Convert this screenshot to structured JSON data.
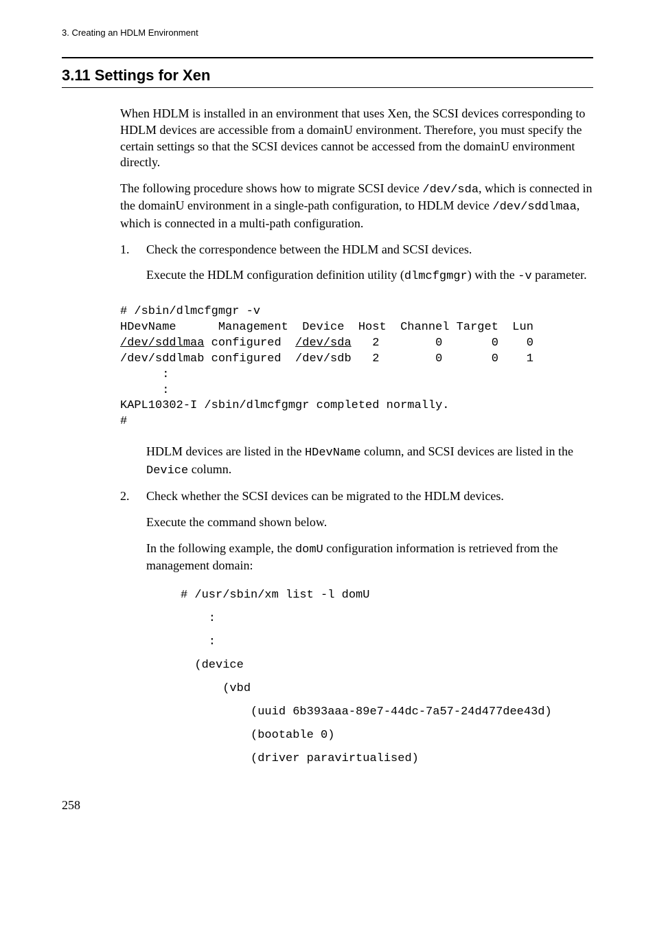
{
  "header": "3. Creating an HDLM Environment",
  "section_title": "3.11 Settings for Xen",
  "para1_pre": "When HDLM is installed in an environment that uses Xen, the SCSI devices corresponding to HDLM devices are accessible from a domainU environment. Therefore, you must specify the certain settings so that the SCSI devices cannot be accessed from the domainU environment directly.",
  "para2": {
    "t1": "The following procedure shows how to migrate SCSI device ",
    "c1": "/dev/sda",
    "t2": ", which is connected in the domainU environment in a single-path configuration, to HDLM device ",
    "c2": "/dev/sddlmaa",
    "t3": ", which is connected in a multi-path configuration."
  },
  "step1": {
    "num": "1.",
    "title": "Check the correspondence between the HDLM and SCSI devices.",
    "sub": {
      "t1": "Execute the HDLM configuration definition utility (",
      "c1": "dlmcfgmgr",
      "t2": ") with the ",
      "c2": "-v",
      "t3": " parameter."
    },
    "code": {
      "l1": "# /sbin/dlmcfgmgr -v",
      "l2": "HDevName      Management  Device  Host  Channel Target  Lun",
      "l3a": "/dev/sddlmaa",
      "l3b": " configured  ",
      "l3c": "/dev/sda",
      "l3d": "   2        0       0    0",
      "l4": "/dev/sddlmab configured  /dev/sdb   2        0       0    1",
      "l5": "      :",
      "l6": "      :",
      "l7": "KAPL10302-I /sbin/dlmcfgmgr completed normally.",
      "l8": "#"
    },
    "after": {
      "t1": "HDLM devices are listed in the ",
      "c1": "HDevName",
      "t2": " column, and SCSI devices are listed in the ",
      "c2": "Device",
      "t3": " column."
    }
  },
  "step2": {
    "num": "2.",
    "title": "Check whether the SCSI devices can be migrated to the HDLM devices.",
    "sub1": "Execute the command shown below.",
    "sub2": {
      "t1": "In the following example, the ",
      "c1": "domU",
      "t2": " configuration information is retrieved from the management domain:"
    },
    "code": {
      "l1": "# /usr/sbin/xm list -l domU",
      "l2": "    :",
      "l3": "    :",
      "l4": "  (device",
      "l5": "      (vbd",
      "l6": "          (uuid 6b393aaa-89e7-44dc-7a57-24d477dee43d)",
      "l7": "          (bootable 0)",
      "l8": "          (driver paravirtualised)"
    }
  },
  "pagenum": "258"
}
